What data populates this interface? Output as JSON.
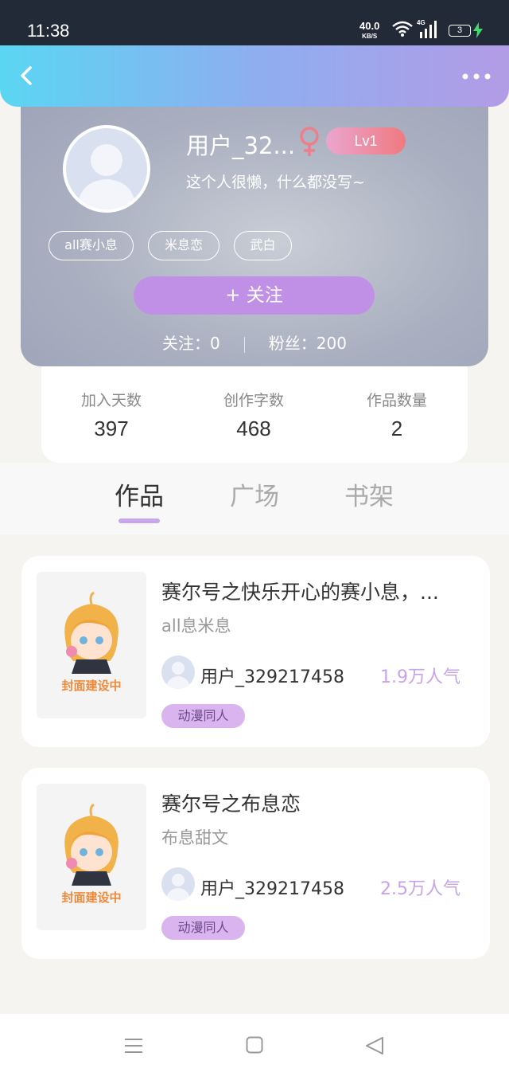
{
  "status_bar": {
    "time": "11:38",
    "net_speed": "40.0",
    "net_speed_unit": "KB/S",
    "network": "4G",
    "battery": "3"
  },
  "nav": {
    "back_icon": "back-arrow-icon",
    "more_icon": "more-dots-icon"
  },
  "profile": {
    "username": "用户_32...",
    "gender_icon": "female-icon",
    "level": "Lv1",
    "bio": "这个人很懒，什么都没写~",
    "tags": [
      "all赛小息",
      "米息恋",
      "武白"
    ],
    "follow_button": "+  关注",
    "following": "关注：0",
    "followers": "粉丝：200"
  },
  "stats": [
    {
      "label": "加入天数",
      "value": "397"
    },
    {
      "label": "创作字数",
      "value": "468"
    },
    {
      "label": "作品数量",
      "value": "2"
    }
  ],
  "tabs": [
    {
      "label": "作品",
      "active": true
    },
    {
      "label": "广场",
      "active": false
    },
    {
      "label": "书架",
      "active": false
    }
  ],
  "works": [
    {
      "title": "赛尔号之快乐开心的赛小息，...",
      "subtitle": "all息米息",
      "cover_caption": "封面建设中",
      "author": "用户_329217458",
      "popularity": "1.9万人气",
      "genre": "动漫同人"
    },
    {
      "title": "赛尔号之布息恋",
      "subtitle": "布息甜文",
      "cover_caption": "封面建设中",
      "author": "用户_329217458",
      "popularity": "2.5万人气",
      "genre": "动漫同人"
    }
  ],
  "colors": {
    "accent": "#bf90e6",
    "popularity": "#c9a3ea",
    "header_start": "#5ad6f2",
    "header_end": "#b29ce6"
  }
}
